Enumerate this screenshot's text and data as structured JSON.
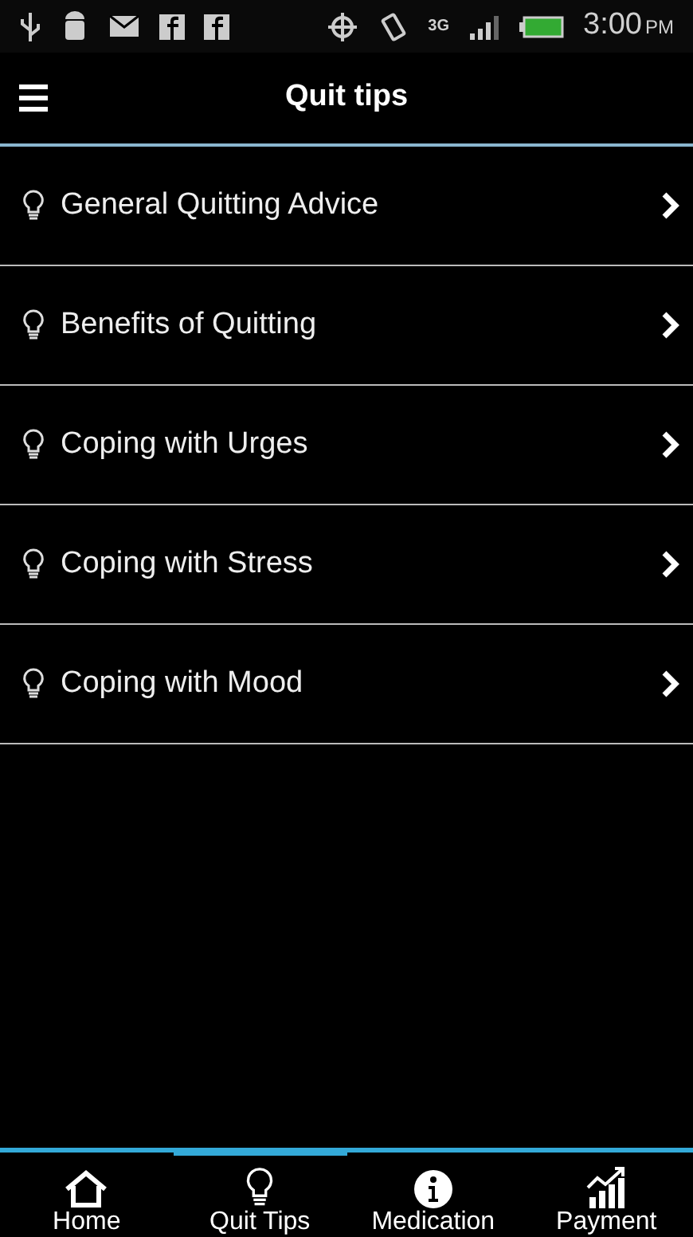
{
  "status_bar": {
    "network": "3G",
    "time": "3:00",
    "meridiem": "PM"
  },
  "header": {
    "title": "Quit tips"
  },
  "tips": [
    {
      "label": "General Quitting Advice"
    },
    {
      "label": "Benefits of Quitting"
    },
    {
      "label": "Coping with Urges"
    },
    {
      "label": "Coping with Stress"
    },
    {
      "label": "Coping with Mood"
    }
  ],
  "nav": [
    {
      "label": "Home",
      "kind": "home",
      "selected": false
    },
    {
      "label": "Quit Tips",
      "kind": "tips",
      "selected": true
    },
    {
      "label": "Medication",
      "kind": "info",
      "selected": false
    },
    {
      "label": "Payment",
      "kind": "chart",
      "selected": false
    }
  ]
}
